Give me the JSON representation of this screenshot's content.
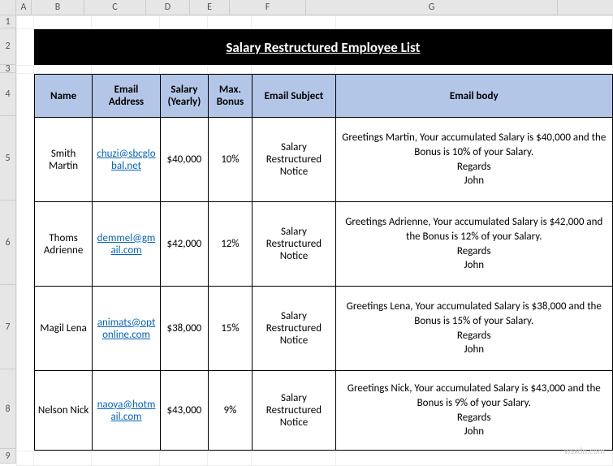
{
  "col_labels": [
    "A",
    "B",
    "C",
    "D",
    "E",
    "F",
    "G"
  ],
  "row_labels": [
    "1",
    "2",
    "3",
    "4",
    "5",
    "6",
    "7",
    "8",
    "9"
  ],
  "title": "Salary Restructured Employee List",
  "headers": {
    "name": "Name",
    "email": "Email Address",
    "salary": "Salary (Yearly)",
    "bonus": "Max. Bonus",
    "subject": "Email Subject",
    "body": "Email body"
  },
  "rows": [
    {
      "name": "Smith Martin",
      "email": "chuzi@sbcglobal.net",
      "salary": "$40,000",
      "bonus": "10%",
      "subject": "Salary Restructured Notice",
      "body": "Greetings Martin, Your accumulated Salary is $40,000 and the Bonus is 10% of your Salary.\nRegards\nJohn"
    },
    {
      "name": "Thoms Adrienne",
      "email": "demmel@gmail.com",
      "salary": "$42,000",
      "bonus": "12%",
      "subject": "Salary Restructured Notice",
      "body": "Greetings Adrienne, Your accumulated Salary is $42,000 and the Bonus is 12% of your Salary.\nRegards\nJohn"
    },
    {
      "name": "Magil Lena",
      "email": "animats@optonline.com",
      "salary": "$38,000",
      "bonus": "15%",
      "subject": "Salary Restructured Notice",
      "body": "Greetings Lena, Your accumulated Salary is $38,000 and the Bonus is 15% of your Salary.\nRegards\nJohn"
    },
    {
      "name": "Nelson Nick",
      "email": "naoya@hotmail.com",
      "salary": "$43,000",
      "bonus": "9%",
      "subject": "Salary Restructured Notice",
      "body": "Greetings Nick, Your accumulated Salary is $43,000 and the Bonus is 9% of your Salary.\nRegards\nJohn"
    }
  ],
  "watermark": "wsxdn.com",
  "chart_data": {
    "type": "table",
    "title": "Salary Restructured Employee List",
    "columns": [
      "Name",
      "Email Address",
      "Salary (Yearly)",
      "Max. Bonus",
      "Email Subject",
      "Email body"
    ],
    "rows": [
      [
        "Smith Martin",
        "chuzi@sbcglobal.net",
        "$40,000",
        "10%",
        "Salary Restructured Notice",
        "Greetings Martin, Your accumulated Salary is $40,000 and the Bonus is 10% of your Salary. Regards John"
      ],
      [
        "Thoms Adrienne",
        "demmel@gmail.com",
        "$42,000",
        "12%",
        "Salary Restructured Notice",
        "Greetings Adrienne, Your accumulated Salary is $42,000 and the Bonus is 12% of your Salary. Regards John"
      ],
      [
        "Magil Lena",
        "animats@optonline.com",
        "$38,000",
        "15%",
        "Salary Restructured Notice",
        "Greetings Lena, Your accumulated Salary is $38,000 and the Bonus is 15% of your Salary. Regards John"
      ],
      [
        "Nelson Nick",
        "naoya@hotmail.com",
        "$43,000",
        "9%",
        "Salary Restructured Notice",
        "Greetings Nick, Your accumulated Salary is $43,000 and the Bonus is 9% of your Salary. Regards John"
      ]
    ]
  }
}
